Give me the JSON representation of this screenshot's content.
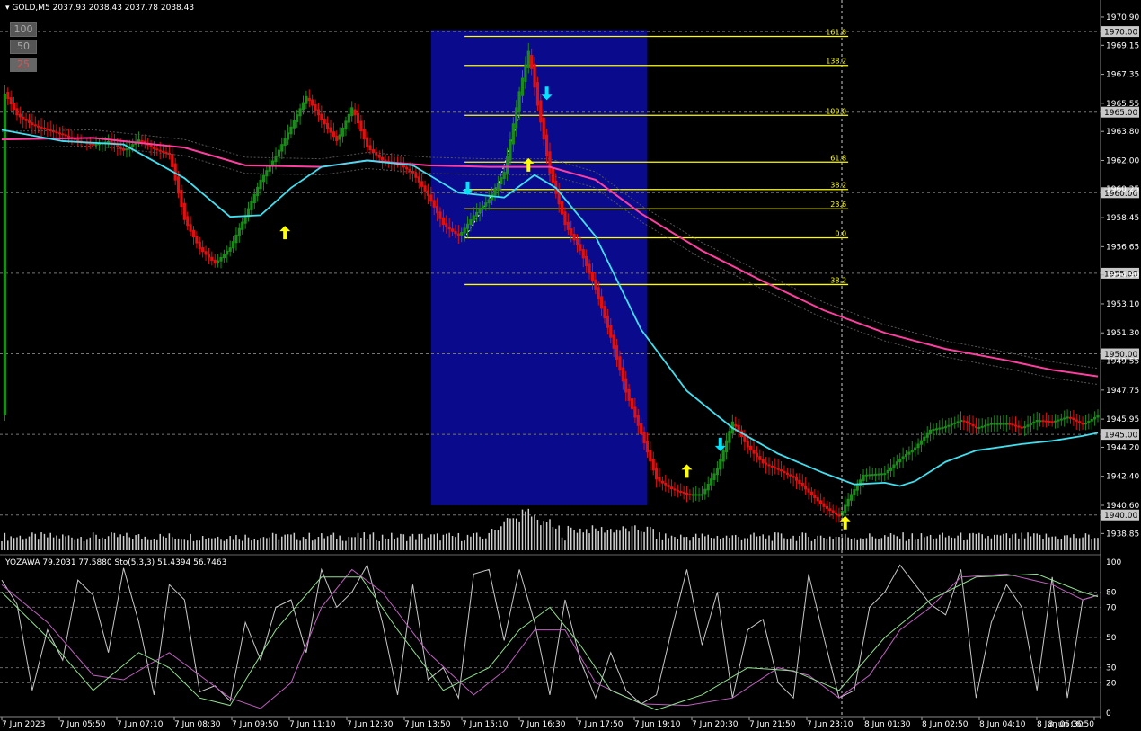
{
  "header": {
    "symbol": "GOLD,M5",
    "ohlc": "2037.93 2038.43 2037.78 2038.43"
  },
  "level_buttons": [
    "100",
    "50",
    "25"
  ],
  "subwindow_label": "YOZAWA 79.2031 77.5880  Sto(5,3,3) 51.4394 56.7463",
  "colors": {
    "bull": "#1a8c1a",
    "bear": "#e01010",
    "ma_fast": "#40e0f0",
    "ma_slow": "#ff3fa0",
    "fib": "#ffff00",
    "highlight": "#0a0a8c",
    "arrow_up": "#ffff00",
    "arrow_down": "#00e5ff",
    "stoch_main": "#c8c8c8",
    "stoch_signal": "#c060c0",
    "yozawa": "#90e090"
  },
  "chart_data": [
    {
      "type": "bar",
      "series_kind": "price candles with moving averages and fibonacci levels",
      "ylim": [
        1938.2,
        1971.4
      ],
      "y_ticks": [
        "1970.90",
        "1969.15",
        "1967.35",
        "1965.55",
        "1963.80",
        "1962.00",
        "1960.25",
        "1958.45",
        "1956.65",
        "1954.90",
        "1953.10",
        "1951.30",
        "1949.55",
        "1947.75",
        "1945.95",
        "1944.20",
        "1942.40",
        "1940.60",
        "1938.85"
      ],
      "y_tick_values": [
        1970.9,
        1969.15,
        1967.35,
        1965.55,
        1963.8,
        1962.0,
        1960.25,
        1958.45,
        1956.65,
        1954.9,
        1953.1,
        1951.3,
        1949.55,
        1947.75,
        1945.95,
        1944.2,
        1942.4,
        1940.6,
        1938.85
      ],
      "price_tags": [
        {
          "label": "1970.00",
          "value": 1970.0
        },
        {
          "label": "1965.00",
          "value": 1965.0
        },
        {
          "label": "1960.00",
          "value": 1960.0
        },
        {
          "label": "1955.00",
          "value": 1955.0
        },
        {
          "label": "1950.00",
          "value": 1950.0
        },
        {
          "label": "1945.00",
          "value": 1945.0
        },
        {
          "label": "1940.00",
          "value": 1940.0
        }
      ],
      "x_labels": [
        "7 Jun 2023",
        "7 Jun 05:50",
        "7 Jun 07:10",
        "7 Jun 08:30",
        "7 Jun 09:50",
        "7 Jun 11:10",
        "7 Jun 12:30",
        "7 Jun 13:50",
        "7 Jun 15:10",
        "7 Jun 16:30",
        "7 Jun 17:50",
        "7 Jun 19:10",
        "7 Jun 20:30",
        "7 Jun 21:50",
        "7 Jun 23:10",
        "8 Jun 01:30",
        "8 Jun 02:50",
        "8 Jun 04:10",
        "8 Jun 05:30",
        "8 Jun 06:50"
      ],
      "close_path": [
        [
          0,
          1966.5
        ],
        [
          5,
          1964.8
        ],
        [
          10,
          1964.2
        ],
        [
          15,
          1963.9
        ],
        [
          20,
          1963.6
        ],
        [
          25,
          1963.2
        ],
        [
          30,
          1963.0
        ],
        [
          35,
          1963.2
        ],
        [
          40,
          1962.6
        ],
        [
          45,
          1963.3
        ],
        [
          50,
          1962.7
        ],
        [
          55,
          1962.4
        ],
        [
          60,
          1958.3
        ],
        [
          65,
          1956.5
        ],
        [
          70,
          1955.6
        ],
        [
          75,
          1956.6
        ],
        [
          80,
          1958.6
        ],
        [
          85,
          1960.8
        ],
        [
          90,
          1962.3
        ],
        [
          95,
          1964.1
        ],
        [
          100,
          1966.0
        ],
        [
          105,
          1964.5
        ],
        [
          110,
          1963.2
        ],
        [
          115,
          1965.3
        ],
        [
          120,
          1962.8
        ],
        [
          125,
          1962.0
        ],
        [
          130,
          1961.8
        ],
        [
          135,
          1961.2
        ],
        [
          140,
          1959.8
        ],
        [
          145,
          1958.0
        ],
        [
          150,
          1957.3
        ],
        [
          155,
          1958.6
        ],
        [
          160,
          1959.6
        ],
        [
          165,
          1961.3
        ],
        [
          170,
          1966.3
        ],
        [
          173,
          1968.8
        ],
        [
          176,
          1965.4
        ],
        [
          180,
          1961.2
        ],
        [
          185,
          1958.0
        ],
        [
          190,
          1956.4
        ],
        [
          195,
          1954.0
        ],
        [
          200,
          1951.0
        ],
        [
          205,
          1947.6
        ],
        [
          210,
          1945.0
        ],
        [
          215,
          1942.2
        ],
        [
          220,
          1941.6
        ],
        [
          225,
          1941.3
        ],
        [
          230,
          1941.3
        ],
        [
          235,
          1942.9
        ],
        [
          240,
          1945.8
        ],
        [
          245,
          1944.2
        ],
        [
          250,
          1943.2
        ],
        [
          255,
          1942.8
        ],
        [
          260,
          1942.3
        ],
        [
          265,
          1941.4
        ],
        [
          270,
          1940.5
        ],
        [
          275,
          1939.9
        ],
        [
          278,
          1941.0
        ],
        [
          283,
          1942.5
        ],
        [
          290,
          1942.6
        ],
        [
          295,
          1943.5
        ],
        [
          300,
          1944.2
        ],
        [
          305,
          1945.3
        ],
        [
          310,
          1945.5
        ],
        [
          315,
          1945.9
        ],
        [
          320,
          1945.4
        ],
        [
          325,
          1945.7
        ],
        [
          330,
          1945.7
        ],
        [
          335,
          1945.4
        ],
        [
          340,
          1945.9
        ],
        [
          345,
          1945.8
        ],
        [
          350,
          1946.1
        ],
        [
          355,
          1945.6
        ],
        [
          360,
          1946.2
        ]
      ],
      "ma_fast": [
        [
          0,
          1963.9
        ],
        [
          20,
          1963.2
        ],
        [
          40,
          1963.0
        ],
        [
          60,
          1960.9
        ],
        [
          75,
          1958.5
        ],
        [
          85,
          1958.6
        ],
        [
          95,
          1960.3
        ],
        [
          105,
          1961.6
        ],
        [
          120,
          1962.0
        ],
        [
          135,
          1961.7
        ],
        [
          150,
          1960.0
        ],
        [
          165,
          1959.7
        ],
        [
          175,
          1961.1
        ],
        [
          182,
          1960.3
        ],
        [
          195,
          1957.3
        ],
        [
          210,
          1951.5
        ],
        [
          225,
          1947.7
        ],
        [
          240,
          1945.4
        ],
        [
          255,
          1943.8
        ],
        [
          270,
          1942.6
        ],
        [
          280,
          1941.9
        ],
        [
          290,
          1942.0
        ],
        [
          295,
          1941.8
        ],
        [
          300,
          1942.1
        ],
        [
          310,
          1943.3
        ],
        [
          320,
          1944.0
        ],
        [
          335,
          1944.4
        ],
        [
          345,
          1944.6
        ],
        [
          355,
          1944.9
        ],
        [
          360,
          1945.1
        ]
      ],
      "ma_slow": [
        [
          0,
          1963.3
        ],
        [
          30,
          1963.4
        ],
        [
          60,
          1962.8
        ],
        [
          80,
          1961.7
        ],
        [
          105,
          1961.6
        ],
        [
          120,
          1962.0
        ],
        [
          140,
          1961.7
        ],
        [
          160,
          1961.6
        ],
        [
          180,
          1961.6
        ],
        [
          195,
          1960.8
        ],
        [
          210,
          1958.7
        ],
        [
          230,
          1956.4
        ],
        [
          250,
          1954.5
        ],
        [
          270,
          1952.7
        ],
        [
          290,
          1951.3
        ],
        [
          310,
          1950.3
        ],
        [
          330,
          1949.6
        ],
        [
          345,
          1949.0
        ],
        [
          360,
          1948.6
        ]
      ],
      "fib_levels": [
        {
          "label": "161.8",
          "value": 1969.7
        },
        {
          "label": "138.2",
          "value": 1967.9
        },
        {
          "label": "100.0",
          "value": 1964.8
        },
        {
          "label": "61.8",
          "value": 1961.9
        },
        {
          "label": "38.2",
          "value": 1960.2
        },
        {
          "label": "23.6",
          "value": 1959.0
        },
        {
          "label": "0.0",
          "value": 1957.2
        },
        {
          "label": "-38.2",
          "value": 1954.3
        }
      ],
      "arrows_up": [
        [
          93,
          1957.5
        ],
        [
          173,
          1961.7
        ],
        [
          225,
          1942.7
        ],
        [
          277,
          1939.5
        ]
      ],
      "arrows_down": [
        [
          153,
          1960.3
        ],
        [
          179,
          1966.2
        ],
        [
          236,
          1944.4
        ]
      ]
    },
    {
      "type": "line",
      "series_kind": "oscillator",
      "ylim": [
        0,
        100
      ],
      "y_ticks": [
        "100",
        "80",
        "70",
        "50",
        "30",
        "20",
        "0"
      ],
      "y_tick_values": [
        100,
        80,
        70,
        50,
        30,
        20,
        0
      ],
      "series": [
        {
          "key": "stoch_main",
          "values": [
            [
              0,
              88
            ],
            [
              5,
              72
            ],
            [
              10,
              15
            ],
            [
              15,
              55
            ],
            [
              20,
              35
            ],
            [
              25,
              88
            ],
            [
              30,
              78
            ],
            [
              35,
              40
            ],
            [
              40,
              96
            ],
            [
              45,
              60
            ],
            [
              50,
              12
            ],
            [
              55,
              85
            ],
            [
              60,
              75
            ],
            [
              65,
              14
            ],
            [
              70,
              18
            ],
            [
              75,
              8
            ],
            [
              80,
              60
            ],
            [
              85,
              35
            ],
            [
              90,
              70
            ],
            [
              95,
              75
            ],
            [
              100,
              40
            ],
            [
              105,
              95
            ],
            [
              110,
              70
            ],
            [
              115,
              80
            ],
            [
              120,
              98
            ],
            [
              125,
              60
            ],
            [
              130,
              12
            ],
            [
              135,
              85
            ],
            [
              140,
              22
            ],
            [
              145,
              30
            ],
            [
              150,
              10
            ],
            [
              155,
              92
            ],
            [
              160,
              95
            ],
            [
              165,
              48
            ],
            [
              170,
              95
            ],
            [
              175,
              60
            ],
            [
              180,
              12
            ],
            [
              185,
              75
            ],
            [
              190,
              35
            ],
            [
              195,
              10
            ],
            [
              200,
              40
            ],
            [
              205,
              15
            ],
            [
              210,
              6
            ],
            [
              215,
              12
            ],
            [
              220,
              55
            ],
            [
              225,
              95
            ],
            [
              230,
              45
            ],
            [
              235,
              80
            ],
            [
              240,
              10
            ],
            [
              245,
              55
            ],
            [
              250,
              62
            ],
            [
              255,
              20
            ],
            [
              260,
              10
            ],
            [
              265,
              92
            ],
            [
              270,
              50
            ],
            [
              275,
              10
            ],
            [
              280,
              15
            ],
            [
              285,
              70
            ],
            [
              290,
              80
            ],
            [
              295,
              98
            ],
            [
              300,
              85
            ],
            [
              305,
              72
            ],
            [
              310,
              65
            ],
            [
              315,
              95
            ],
            [
              320,
              10
            ],
            [
              325,
              60
            ],
            [
              330,
              85
            ],
            [
              335,
              70
            ],
            [
              340,
              15
            ],
            [
              345,
              90
            ],
            [
              350,
              10
            ],
            [
              355,
              75
            ],
            [
              360,
              78
            ]
          ]
        },
        {
          "key": "stoch_signal",
          "values": [
            [
              0,
              85
            ],
            [
              15,
              60
            ],
            [
              30,
              25
            ],
            [
              40,
              22
            ],
            [
              55,
              40
            ],
            [
              65,
              25
            ],
            [
              75,
              10
            ],
            [
              85,
              3
            ],
            [
              95,
              20
            ],
            [
              105,
              70
            ],
            [
              115,
              95
            ],
            [
              125,
              80
            ],
            [
              140,
              40
            ],
            [
              155,
              12
            ],
            [
              165,
              28
            ],
            [
              175,
              55
            ],
            [
              185,
              55
            ],
            [
              195,
              20
            ],
            [
              210,
              6
            ],
            [
              225,
              5
            ],
            [
              240,
              10
            ],
            [
              255,
              30
            ],
            [
              265,
              25
            ],
            [
              275,
              10
            ],
            [
              285,
              25
            ],
            [
              295,
              55
            ],
            [
              305,
              70
            ],
            [
              315,
              90
            ],
            [
              330,
              92
            ],
            [
              345,
              85
            ],
            [
              355,
              75
            ],
            [
              360,
              78
            ]
          ]
        },
        {
          "key": "yozawa",
          "values": [
            [
              0,
              80
            ],
            [
              15,
              50
            ],
            [
              30,
              15
            ],
            [
              45,
              40
            ],
            [
              55,
              30
            ],
            [
              65,
              10
            ],
            [
              75,
              5
            ],
            [
              90,
              55
            ],
            [
              105,
              90
            ],
            [
              118,
              90
            ],
            [
              130,
              55
            ],
            [
              145,
              15
            ],
            [
              160,
              30
            ],
            [
              170,
              55
            ],
            [
              180,
              70
            ],
            [
              190,
              45
            ],
            [
              200,
              15
            ],
            [
              215,
              2
            ],
            [
              230,
              12
            ],
            [
              245,
              30
            ],
            [
              260,
              28
            ],
            [
              275,
              15
            ],
            [
              290,
              50
            ],
            [
              305,
              75
            ],
            [
              320,
              90
            ],
            [
              340,
              92
            ],
            [
              355,
              80
            ],
            [
              360,
              77
            ]
          ]
        }
      ]
    }
  ]
}
